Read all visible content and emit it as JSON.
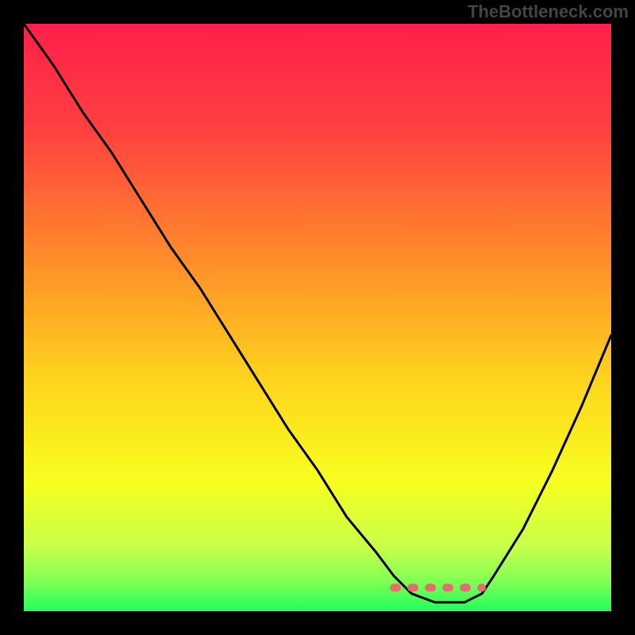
{
  "watermark": "TheBottleneck.com",
  "chart_data": {
    "type": "line",
    "title": "",
    "xlabel": "",
    "ylabel": "",
    "xlim": [
      0,
      100
    ],
    "ylim": [
      0,
      100
    ],
    "grid": false,
    "legend": false,
    "series": [
      {
        "name": "bottleneck-curve",
        "x": [
          0,
          5,
          10,
          15,
          20,
          25,
          30,
          35,
          40,
          45,
          50,
          55,
          60,
          63,
          66,
          70,
          75,
          78,
          80,
          85,
          90,
          95,
          100
        ],
        "y": [
          100,
          93,
          85,
          78,
          70,
          62,
          55,
          47,
          39,
          31,
          24,
          16,
          10,
          6,
          3,
          1.5,
          1.5,
          3,
          6,
          14,
          24,
          35,
          47
        ]
      }
    ],
    "annotations": {
      "optimal_band": {
        "x_start": 63,
        "x_end": 78,
        "y": 4
      }
    },
    "background_gradient": {
      "stops": [
        {
          "offset": 0.0,
          "color": "#ff1f4a"
        },
        {
          "offset": 0.18,
          "color": "#ff4040"
        },
        {
          "offset": 0.4,
          "color": "#ff8c2a"
        },
        {
          "offset": 0.6,
          "color": "#ffd21e"
        },
        {
          "offset": 0.78,
          "color": "#f7ff1e"
        },
        {
          "offset": 0.89,
          "color": "#c8ff4a"
        },
        {
          "offset": 0.95,
          "color": "#7fff55"
        },
        {
          "offset": 1.0,
          "color": "#1fff5a"
        }
      ]
    },
    "colors": {
      "curve": "#000000",
      "dash": "#e07070",
      "frame": "#000000"
    }
  }
}
